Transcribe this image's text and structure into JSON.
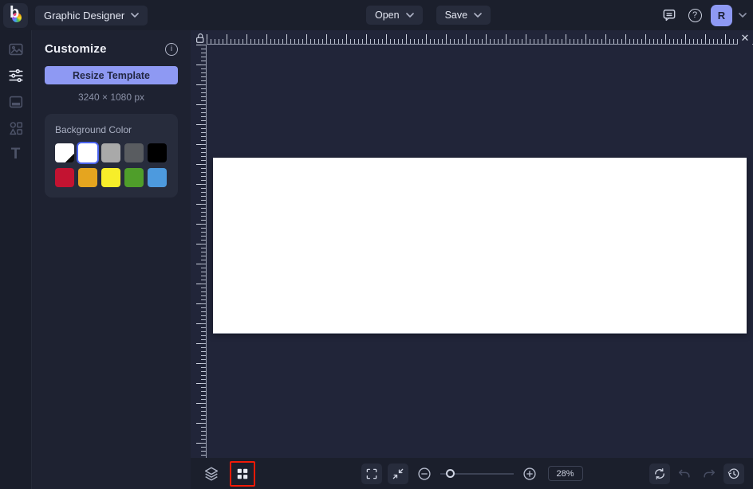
{
  "topbar": {
    "logo_letter": "b",
    "mode_label": "Graphic Designer",
    "open_label": "Open",
    "save_label": "Save",
    "avatar_initial": "R"
  },
  "sidebar": {
    "icons": [
      "image-manager-icon",
      "customize-sliders-icon",
      "templates-layout-icon",
      "graphics-shapes-icon",
      "text-tool-icon"
    ],
    "active_item": "customize"
  },
  "panel": {
    "title": "Customize",
    "resize_button_label": "Resize Template",
    "template_size": "3240 × 1080 px",
    "background_color": {
      "label": "Background Color",
      "swatches": [
        {
          "name": "transparent",
          "color": "#ffffff",
          "selected": false
        },
        {
          "name": "white",
          "color": "#ffffff",
          "selected": true
        },
        {
          "name": "light-gray",
          "color": "#a9a9a9",
          "selected": false
        },
        {
          "name": "dark-gray",
          "color": "#595c60",
          "selected": false
        },
        {
          "name": "black",
          "color": "#000000",
          "selected": false
        },
        {
          "name": "crimson",
          "color": "#c31331",
          "selected": false
        },
        {
          "name": "orange",
          "color": "#e5a51f",
          "selected": false
        },
        {
          "name": "yellow",
          "color": "#f7ee2a",
          "selected": false
        },
        {
          "name": "green",
          "color": "#4f9e2a",
          "selected": false
        },
        {
          "name": "blue",
          "color": "#4d9ade",
          "selected": false
        }
      ]
    }
  },
  "stage": {
    "ruler_lock": "open-padlock-icon",
    "close_glyph": "✕"
  },
  "toolbar": {
    "zoom_percent": "28%"
  },
  "glyphs": {
    "help": "?",
    "info": "i",
    "text_tool": "T"
  },
  "colors": {
    "accent": "#8e99f3",
    "selection_ring": "#4a63ee",
    "highlight_red": "#f11a07",
    "canvas": "#ffffff"
  }
}
